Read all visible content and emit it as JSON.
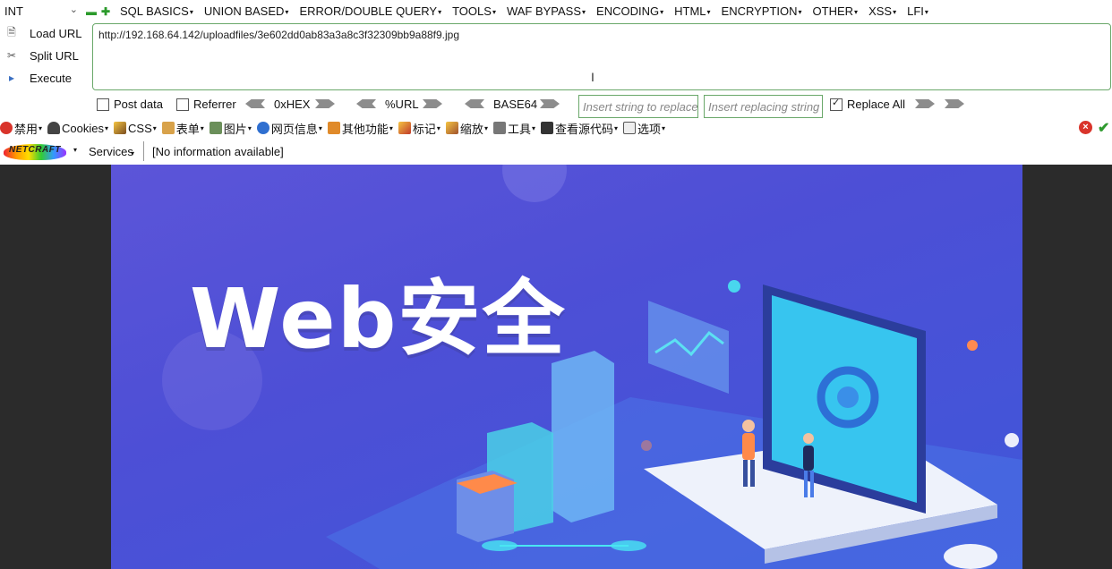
{
  "hackbar": {
    "select_value": "INT",
    "menus": [
      "SQL BASICS",
      "UNION BASED",
      "ERROR/DOUBLE QUERY",
      "TOOLS",
      "WAF BYPASS",
      "ENCODING",
      "HTML",
      "ENCRYPTION",
      "OTHER",
      "XSS",
      "LFI"
    ],
    "actions": {
      "load": "Load URL",
      "split": "Split URL",
      "execute": "Execute"
    },
    "url": "http://192.168.64.142/uploadfiles/3e602dd0ab83a3a8c3f32309bb9a88f9.jpg",
    "post_data_label": "Post data",
    "referrer_label": "Referrer",
    "hex_label": "0xHEX",
    "url_label": "%URL",
    "base64_label": "BASE64",
    "replace_placeholder": "Insert string to replace",
    "replacing_placeholder": "Insert replacing string",
    "replace_all_label": "Replace All"
  },
  "toolbar": {
    "items": [
      "禁用",
      "Cookies",
      "CSS",
      "表单",
      "图片",
      "网页信息",
      "其他功能",
      "标记",
      "缩放",
      "工具",
      "查看源代码",
      "选项"
    ]
  },
  "netcraft": {
    "logo": "NETCRAFT",
    "services_label": "Services",
    "info": "[No information available]"
  },
  "banner": {
    "title": "Web安全"
  },
  "colors": {
    "accent_green": "#6aa86a",
    "banner_bg": "#4d4fd6"
  }
}
